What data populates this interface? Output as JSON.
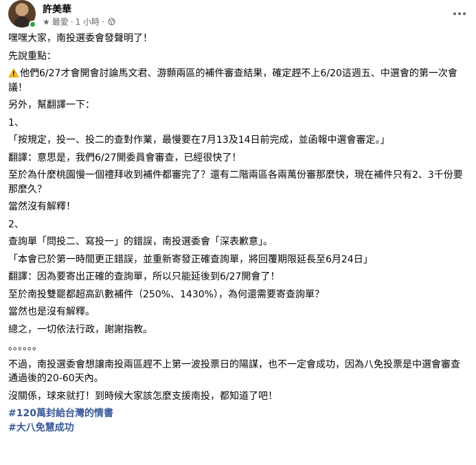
{
  "post": {
    "author": "許美華",
    "meta_label": "最愛",
    "meta_dot": "·",
    "time": "1 小時",
    "paragraphs": [
      "嘿嘿大家，南投選委會發聲明了！",
      "先說重點：",
      "他們6/27才會開會討論馬文君、游顥兩區的補件審查結果，確定趕不上6/20這週五、中選會的第一次會議！",
      "另外，幫翻譯一下：",
      "1、",
      "「按規定，投一、投二的查對作業，最慢要在7月13及14日前完成，並函報中選會審定。」",
      "翻譯：意思是，我們6/27開委員會審查，已經很快了！",
      "至於為什麼桃園慢一個禮拜收到補件都審完了？還有二階兩區各兩萬份審那麼快，現在補件只有2、3千份要那麼久？",
      "當然沒有解釋！",
      "2、",
      "查詢單「問投二、寫投一」的錯誤，南投選委會「深表歉意」。",
      "「本會已於第一時間更正錯誤，並重新寄發正確查詢單，將回覆期限延長至6月24日」",
      "翻譯：因為要寄出正確的查詢單，所以只能延後到6/27開會了！",
      "至於南投雙罷都超高趴數補件（250%、1430%），為何還需要寄查詢單？",
      "當然也是沒有解釋。",
      "總之，一切依法行政，謝謝指教。",
      "。。。。。。",
      "不過，南投選委會想讓南投兩區趕不上第一波投票日的陽謀，也不一定會成功，因為八免投票是中選會審查通過後的20-60天內。",
      "沒關係，球來就打！到時候大家該怎麼支援南投，都知道了吧！"
    ],
    "hashtags": [
      "#120萬封給台灣的情書",
      "#大八免慧成功"
    ]
  },
  "colors": {
    "text": "#050505",
    "secondary": "#65676b",
    "hashtag": "#385898",
    "online": "#31a24c",
    "warning": "#f7b928"
  },
  "icons": {
    "warning": "warning-icon",
    "favorite": "star-icon",
    "audience": "globe-icon",
    "menu": "more-icon"
  }
}
